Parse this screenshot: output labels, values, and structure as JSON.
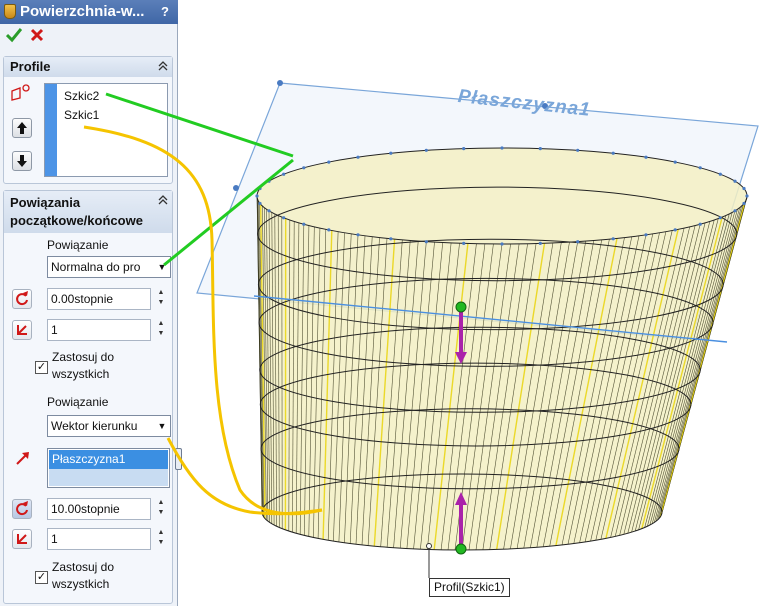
{
  "title": "Powierzchnia-w...",
  "help": "?",
  "profile": {
    "header": "Profile",
    "items": [
      "Szkic2",
      "Szkic1"
    ]
  },
  "constraints": {
    "header_line1": "Powiązania",
    "header_line2": "początkowe/końcowe",
    "start": {
      "label": "Powiązanie",
      "value": "Normalna do pro",
      "angle": "0.00stopnie",
      "length": "1",
      "apply_all_line1": "Zastosuj do",
      "apply_all_line2": "wszystkich",
      "apply_all_checked": true
    },
    "end": {
      "label": "Powiązanie",
      "value": "Wektor kierunku",
      "direction_item": "Płaszczyzna1",
      "angle": "10.00stopnie",
      "length": "1",
      "apply_all_line1": "Zastosuj do",
      "apply_all_line2": "wszystkich",
      "apply_all_checked": true
    }
  },
  "viewport": {
    "plane_label": "Płaszczyzna1",
    "callout": "Profil(Szkic1)"
  },
  "colors": {
    "title_bar": "#4a72b0",
    "surface": "#f3f0c3",
    "green_leader": "#22cc22",
    "yellow_leader": "#f5c400",
    "handle": "#aa22aa",
    "plane": "#7aa6d9"
  },
  "icons": {
    "ok": "check-icon",
    "cancel": "cross-icon",
    "collapse": "double-chevron-up-icon",
    "move_up": "arrow-up-icon",
    "move_down": "arrow-down-icon",
    "direction": "red-arrow-icon",
    "reverse": "circular-arrow-icon"
  }
}
